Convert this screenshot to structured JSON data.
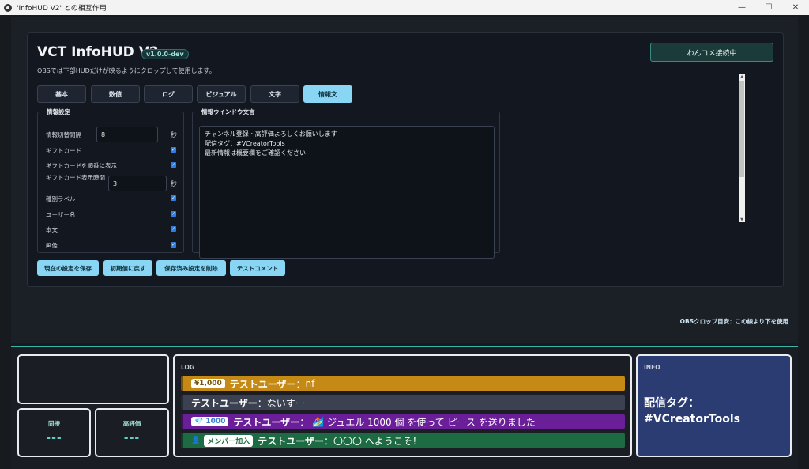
{
  "window": {
    "title": "'InfoHUD V2' との相互作用",
    "minimize": "—",
    "maximize": "☐",
    "close": "✕"
  },
  "header": {
    "app_title": "VCT InfoHUD V2",
    "version": "v1.0.0-dev",
    "subtitle": "OBSでは下部HUDだけが映るようにクロップして使用します。",
    "connect_label": "わんコメ接続中"
  },
  "tabs": [
    {
      "label": "基本"
    },
    {
      "label": "数値"
    },
    {
      "label": "ログ"
    },
    {
      "label": "ビジュアル"
    },
    {
      "label": "文字"
    },
    {
      "label": "情報文",
      "active": true
    }
  ],
  "settings": {
    "legend": "情報設定",
    "interval_label": "情報切替間隔",
    "interval_value": "8",
    "interval_unit": "秒",
    "giftcard_label": "ギフトカード",
    "giftcard_order_label": "ギフトカードを順番に表示",
    "giftcard_time_label": "ギフトカード表示時間",
    "giftcard_time_value": "3",
    "giftcard_time_unit": "秒",
    "type_label": "種別ラベル",
    "username_label": "ユーザー名",
    "body_label": "本文",
    "image_label": "画像",
    "checkmark": "✓"
  },
  "window_text": {
    "legend": "情報ウインドウ文言",
    "lines": [
      "チャンネル登録・高評価よろしくお願いします",
      "配信タグ：#VCreatorTools",
      "最新情報は概要欄をご確認ください"
    ]
  },
  "actions": {
    "save": "現在の設定を保存",
    "reset": "初期値に戻す",
    "delete": "保存済み設定を削除",
    "test": "テストコメント"
  },
  "crop_note": "OBSクロップ目安：この線より下を使用",
  "hud": {
    "stat1_label": "同接",
    "stat1_value": "---",
    "stat2_label": "高評価",
    "stat2_value": "---",
    "log_label": "LOG",
    "log": [
      {
        "pill": "¥1,000",
        "user": "テストユーザー",
        "sep": "：",
        "text": "nf",
        "color": "#c48a15"
      },
      {
        "pill": "",
        "user": "テストユーザー",
        "sep": "：",
        "text": "ないすー",
        "color": "#3b4150"
      },
      {
        "pill": "1000",
        "pill_icon": "💎",
        "user": "テストユーザー",
        "sep": "：",
        "emoji": "🏄",
        "text": "ジュエル 1000 個 を使って ピース を送りました",
        "color": "#6a1e98"
      },
      {
        "pill": "メンバー加入",
        "badge": "👤",
        "user": "テストユーザー",
        "sep": "：",
        "text": "〇〇〇 へようこそ！",
        "color": "#1d6b42"
      }
    ],
    "info_label": "INFO",
    "info_line1": "配信タグ：",
    "info_line2": "#VCreatorTools"
  }
}
